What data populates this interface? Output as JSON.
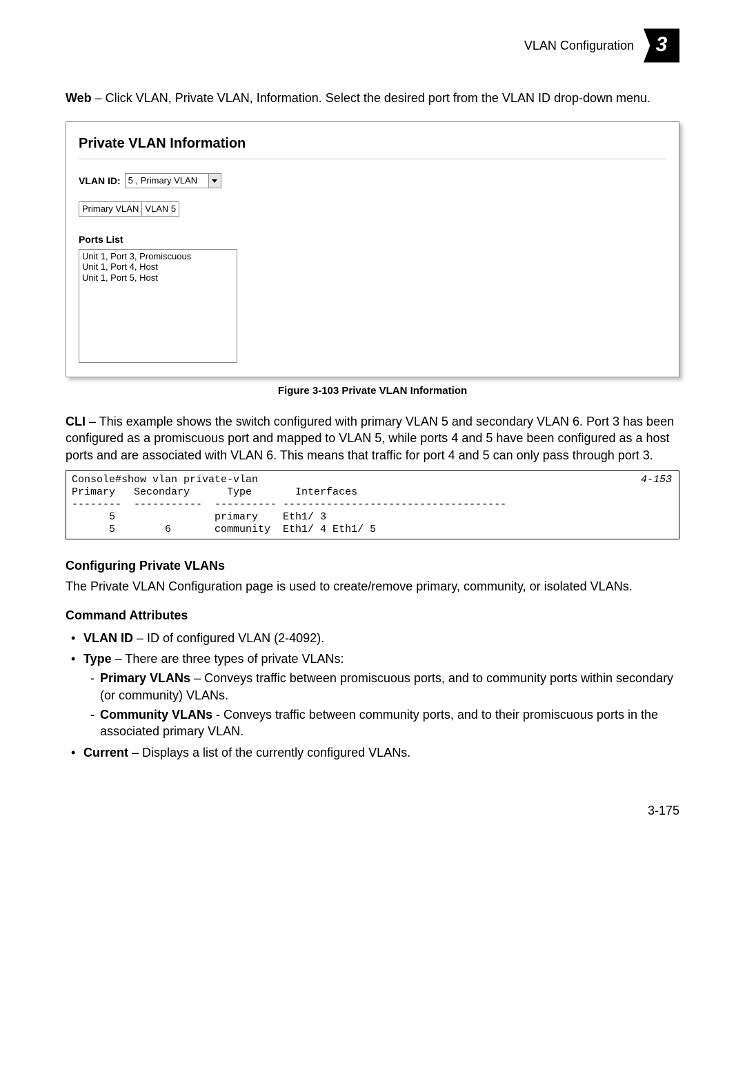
{
  "header": {
    "title": "VLAN Configuration",
    "chapter": "3"
  },
  "intro": {
    "bold": "Web",
    "text": " – Click VLAN, Private VLAN, Information. Select the desired port from the VLAN ID drop-down menu."
  },
  "panel": {
    "title": "Private VLAN Information",
    "vlanIdLabel": "VLAN ID:",
    "vlanIdValue": "5 , Primary VLAN",
    "miniCol1": "Primary VLAN",
    "miniCol2": "VLAN 5",
    "portsListLabel": "Ports List",
    "ports": [
      "Unit 1, Port 3, Promiscuous",
      "Unit 1, Port 4, Host",
      "Unit 1, Port 5, Host"
    ]
  },
  "figureCaption": "Figure 3-103  Private VLAN Information",
  "cliIntro": {
    "bold": "CLI",
    "text": " – This example shows the switch configured with primary VLAN 5 and secondary VLAN 6. Port 3 has been configured as a promiscuous port and mapped to VLAN 5, while ports 4 and 5 have been configured as a host ports and are associated with VLAN 6. This means that traffic for port 4 and 5 can only pass through port 3."
  },
  "cli": {
    "ref": "4-153",
    "lines": [
      "Console#show vlan private-vlan",
      "Primary   Secondary      Type       Interfaces",
      "--------  -----------  ---------- ------------------------------------",
      "      5                primary    Eth1/ 3",
      "      5        6       community  Eth1/ 4 Eth1/ 5"
    ]
  },
  "section": {
    "heading": "Configuring Private VLANs",
    "desc": "The Private VLAN Configuration page is used to create/remove primary, community, or isolated VLANs."
  },
  "attrs": {
    "heading": "Command Attributes",
    "items": [
      {
        "bold": "VLAN ID",
        "text": " – ID of configured VLAN (2-4092)."
      },
      {
        "bold": "Type",
        "text": " – There are three types of private VLANs:",
        "sub": [
          {
            "bold": "Primary VLANs",
            "text": " – Conveys traffic between promiscuous ports, and to community ports within secondary (or community) VLANs."
          },
          {
            "bold": "Community VLANs",
            "text": " - Conveys traffic between community ports, and to their promiscuous ports in the associated primary VLAN."
          }
        ]
      },
      {
        "bold": "Current",
        "text": " – Displays a list of the currently configured VLANs."
      }
    ]
  },
  "pageNumber": "3-175"
}
